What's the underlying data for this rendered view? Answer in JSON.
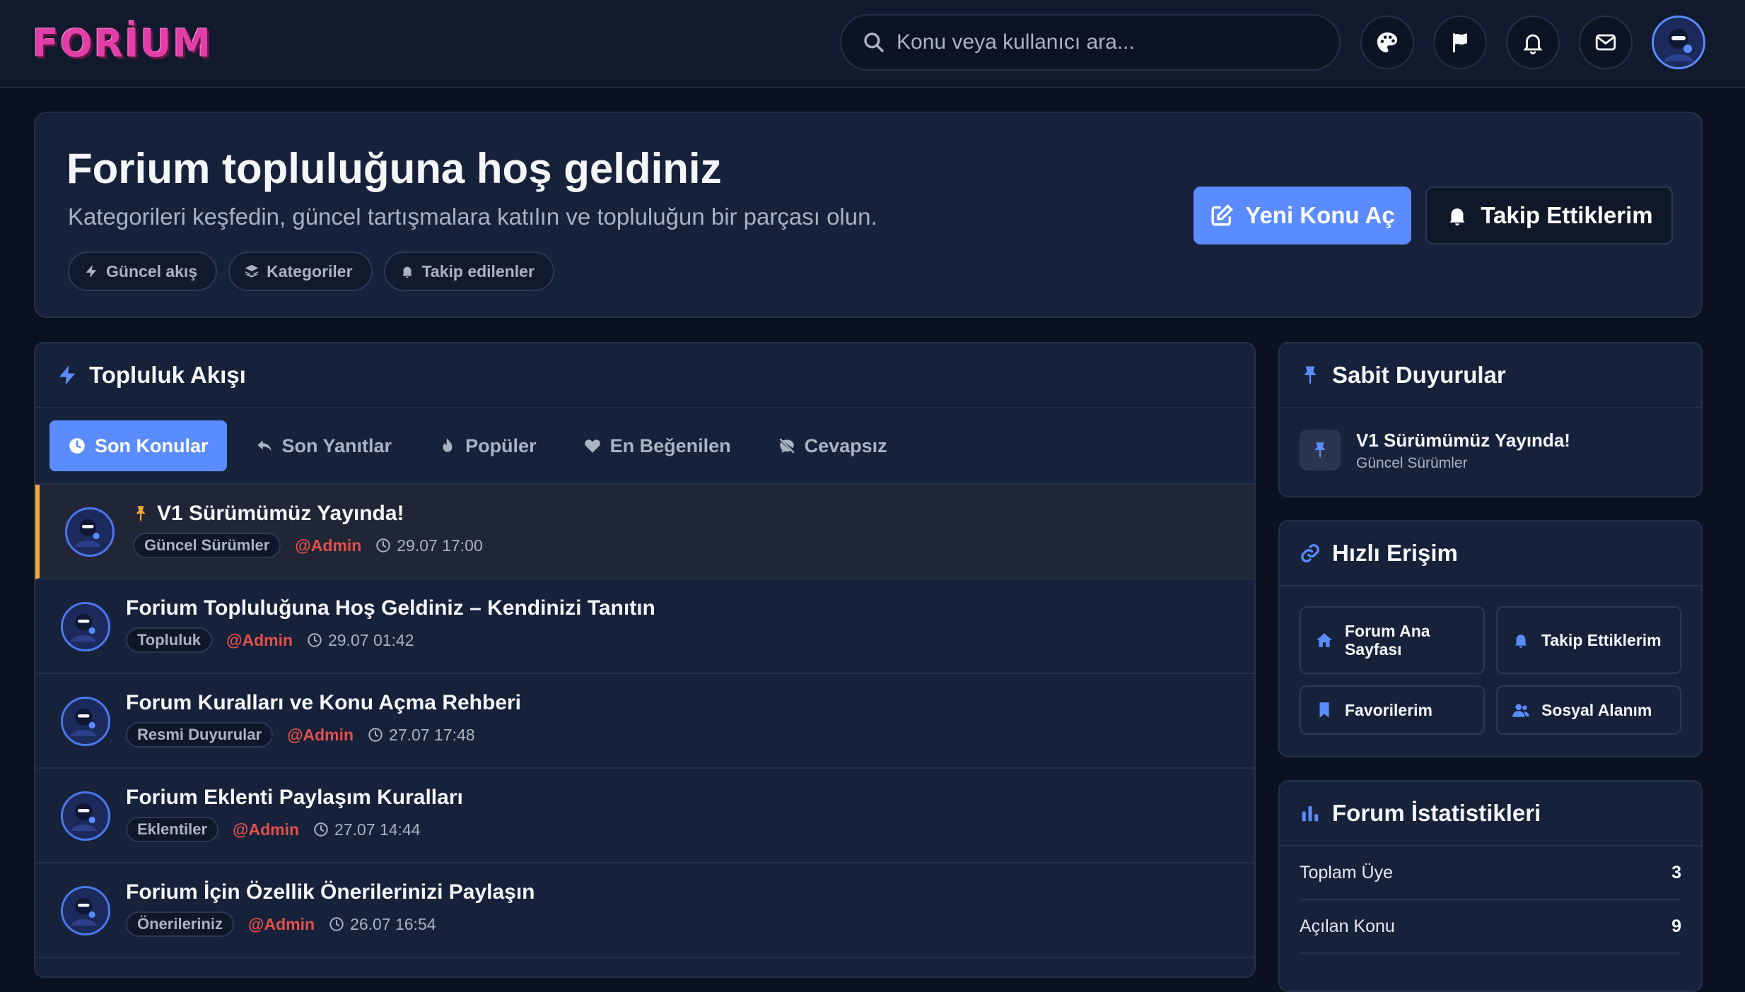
{
  "header": {
    "logo": "FORİUM",
    "search_placeholder": "Konu veya kullanıcı ara...",
    "icons": [
      "palette-icon",
      "flag-icon",
      "bell-icon",
      "envelope-icon"
    ]
  },
  "hero": {
    "title": "Forium topluluğuna hoş geldiniz",
    "subtitle": "Kategorileri keşfedin, güncel tartışmalara katılın ve topluluğun bir parçası olun.",
    "chips": [
      "Güncel akış",
      "Kategoriler",
      "Takip edilenler"
    ],
    "primary_button": "Yeni Konu Aç",
    "secondary_button": "Takip Ettiklerim"
  },
  "feed": {
    "title": "Topluluk Akışı",
    "tabs": [
      "Son Konular",
      "Son Yanıtlar",
      "Popüler",
      "En Beğenilen",
      "Cevapsız"
    ],
    "active_tab": "Son Konular",
    "topics": [
      {
        "title": "V1 Sürümümüz Yayında!",
        "category": "Güncel Sürümler",
        "author": "@Admin",
        "time": "29.07 17:00",
        "pinned": true
      },
      {
        "title": "Forium Topluluğuna Hoş Geldiniz – Kendinizi Tanıtın",
        "category": "Topluluk",
        "author": "@Admin",
        "time": "29.07 01:42",
        "pinned": false
      },
      {
        "title": "Forum Kuralları ve Konu Açma Rehberi",
        "category": "Resmi Duyurular",
        "author": "@Admin",
        "time": "27.07 17:48",
        "pinned": false
      },
      {
        "title": "Forium Eklenti Paylaşım Kuralları",
        "category": "Eklentiler",
        "author": "@Admin",
        "time": "27.07 14:44",
        "pinned": false
      },
      {
        "title": "Forium İçin Özellik Önerilerinizi Paylaşın",
        "category": "Önerileriniz",
        "author": "@Admin",
        "time": "26.07 16:54",
        "pinned": false
      }
    ]
  },
  "sidebar": {
    "announcements": {
      "title": "Sabit Duyurular",
      "item_title": "V1 Sürümümüz Yayında!",
      "item_sub": "Güncel Sürümler"
    },
    "quick_access": {
      "title": "Hızlı Erişim",
      "items": [
        "Forum Ana Sayfası",
        "Takip Ettiklerim",
        "Favorilerim",
        "Sosyal Alanım"
      ]
    },
    "stats": {
      "title": "Forum İstatistikleri",
      "rows": [
        {
          "label": "Toplam Üye",
          "value": "3"
        },
        {
          "label": "Açılan Konu",
          "value": "9"
        }
      ]
    }
  },
  "colors": {
    "accent": "#5b8cff",
    "author": "#e2504b",
    "pinned": "#f0a93a",
    "logo": "#e13fa7"
  }
}
